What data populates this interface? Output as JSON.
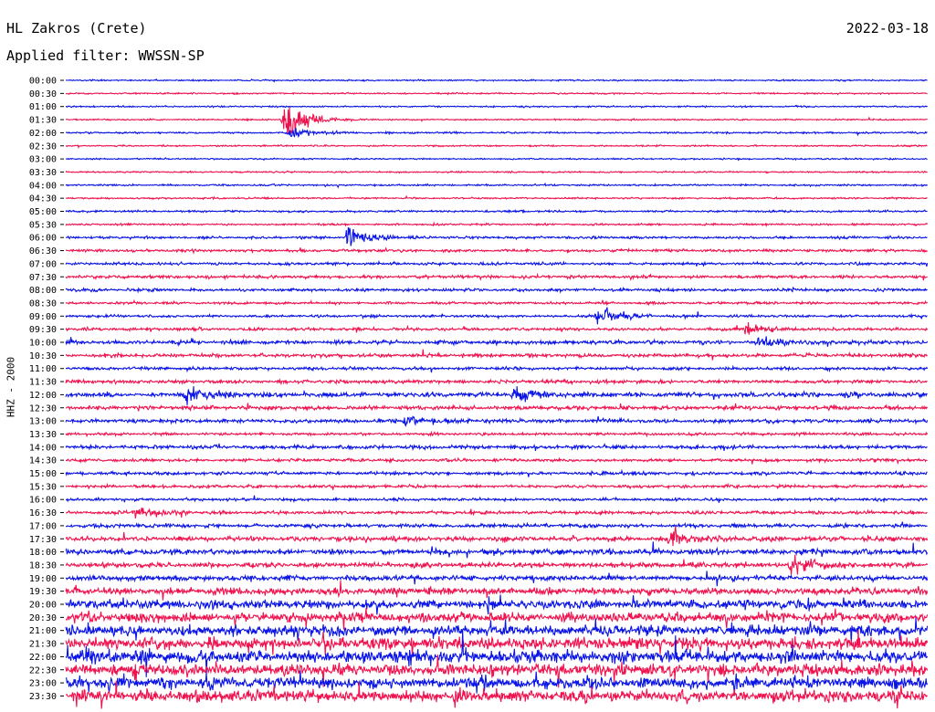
{
  "header": {
    "station": "HL Zakros (Crete)",
    "date": "2022-03-18",
    "filter": "Applied filter: WWSSN-SP",
    "channel": "HHZ - 2000"
  },
  "colors": {
    "trace_a": "#0a14e6",
    "trace_b": "#f0124e",
    "text": "#000000",
    "background": "#ffffff"
  },
  "chart_data": {
    "type": "line",
    "title": "",
    "xlabel": "",
    "ylabel": "HHZ - 2000",
    "description_of_series": "helicorder: 48 rows of 30 minutes each, alternating blue/red",
    "row_labels": [
      "00:00",
      "00:30",
      "01:00",
      "01:30",
      "02:00",
      "02:30",
      "03:00",
      "03:30",
      "04:00",
      "04:30",
      "05:00",
      "05:30",
      "06:00",
      "06:30",
      "07:00",
      "07:30",
      "08:00",
      "08:30",
      "09:00",
      "09:30",
      "10:00",
      "10:30",
      "11:00",
      "11:30",
      "12:00",
      "12:30",
      "13:00",
      "13:30",
      "14:00",
      "14:30",
      "15:00",
      "15:30",
      "16:00",
      "16:30",
      "17:00",
      "17:30",
      "18:00",
      "18:30",
      "19:00",
      "19:30",
      "20:00",
      "20:30",
      "21:00",
      "21:30",
      "22:00",
      "22:30",
      "23:00",
      "23:30"
    ],
    "row_noise_level": [
      0.6,
      0.6,
      0.6,
      0.6,
      0.7,
      0.6,
      0.6,
      0.6,
      0.7,
      0.7,
      0.8,
      0.8,
      1.0,
      1.1,
      1.1,
      1.2,
      1.2,
      1.0,
      1.0,
      1.2,
      1.6,
      1.4,
      1.2,
      1.4,
      1.8,
      1.7,
      1.5,
      1.1,
      1.5,
      1.2,
      1.3,
      1.2,
      1.1,
      1.3,
      1.5,
      1.9,
      2.2,
      1.9,
      2.1,
      2.7,
      3.4,
      3.8,
      4.2,
      4.8,
      5.0,
      4.8,
      4.6,
      4.6
    ],
    "events": [
      {
        "row": 3,
        "minute": 7.6,
        "amplitude": 22
      },
      {
        "row": 4,
        "minute": 7.8,
        "amplitude": 5
      },
      {
        "row": 12,
        "minute": 9.8,
        "amplitude": 12
      },
      {
        "row": 18,
        "minute": 18.5,
        "amplitude": 10
      },
      {
        "row": 19,
        "minute": 23.6,
        "amplitude": 5
      },
      {
        "row": 20,
        "minute": 24.1,
        "amplitude": 6
      },
      {
        "row": 24,
        "minute": 4.2,
        "amplitude": 8
      },
      {
        "row": 24,
        "minute": 15.6,
        "amplitude": 9
      },
      {
        "row": 26,
        "minute": 11.8,
        "amplitude": 5
      },
      {
        "row": 33,
        "minute": 2.4,
        "amplitude": 6
      },
      {
        "row": 35,
        "minute": 21.0,
        "amplitude": 10
      },
      {
        "row": 37,
        "minute": 25.2,
        "amplitude": 9
      }
    ]
  }
}
